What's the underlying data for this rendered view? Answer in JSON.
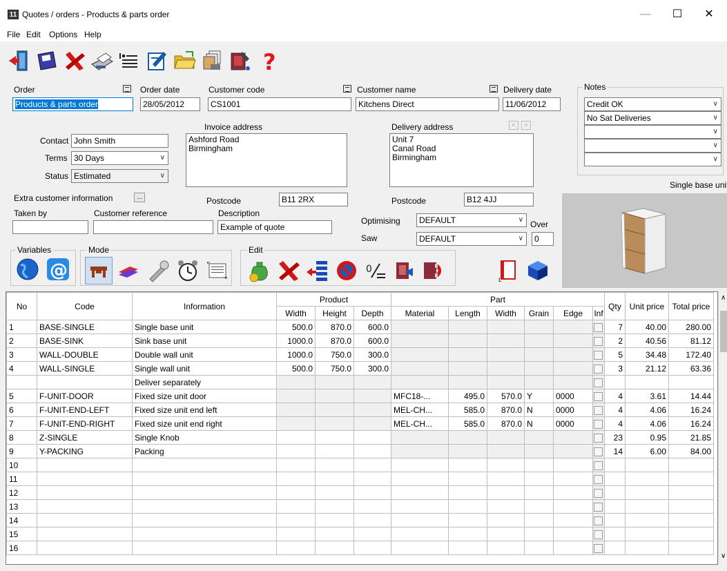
{
  "window": {
    "title": "Quotes / orders - Products & parts order",
    "min": "—",
    "max": "☐",
    "close": "✕",
    "app_icon_text": "11"
  },
  "menu": [
    "File",
    "Edit",
    "Options",
    "Help"
  ],
  "toolbar_icons": [
    "exit-icon",
    "save-icon",
    "delete-icon",
    "print-icon",
    "list-format-icon",
    "edit-note-icon",
    "open-folder-icon",
    "copy-orders-icon",
    "book-tools-icon",
    "help-icon"
  ],
  "help_glyph": "?",
  "order": {
    "label": "Order",
    "value": "Products & parts order",
    "order_date_label": "Order date",
    "order_date": "28/05/2012",
    "customer_code_label": "Customer code",
    "customer_code": "CS1001",
    "customer_name_label": "Customer name",
    "customer_name": "Kitchens Direct",
    "delivery_date_label": "Delivery date",
    "delivery_date": "11/06/2012"
  },
  "notes": {
    "label": "Notes",
    "items": [
      "Credit OK",
      "No Sat Deliveries",
      "",
      "",
      ""
    ]
  },
  "contact": {
    "contact_label": "Contact",
    "contact": "John Smith",
    "terms_label": "Terms",
    "terms": "30 Days",
    "status_label": "Status",
    "status": "Estimated"
  },
  "invoice": {
    "label": "Invoice address",
    "lines": [
      "Ashford Road",
      "Birmingham"
    ],
    "postcode_label": "Postcode",
    "postcode": "B11 2RX"
  },
  "delivery": {
    "label": "Delivery address",
    "lines": [
      "Unit 7",
      "Canal Road",
      "Birmingham"
    ],
    "postcode_label": "Postcode",
    "postcode": "B12 4JJ",
    "prev": "<",
    "next": ">"
  },
  "extra": {
    "label": "Extra customer information",
    "btn": "...",
    "taken_by_label": "Taken by",
    "taken_by": "",
    "customer_ref_label": "Customer reference",
    "customer_ref": "",
    "description_label": "Description",
    "description": "Example of quote"
  },
  "optimising": {
    "label": "Optimising",
    "value": "DEFAULT",
    "saw_label": "Saw",
    "saw": "DEFAULT",
    "over_label": "Over",
    "over": "0"
  },
  "preview": {
    "label": "Single base unit"
  },
  "groups": {
    "variables": "Variables",
    "mode": "Mode",
    "edit": "Edit"
  },
  "grid": {
    "headers": {
      "no": "No",
      "code": "Code",
      "information": "Information",
      "product": "Product",
      "width": "Width",
      "height": "Height",
      "depth": "Depth",
      "part": "Part",
      "material": "Material",
      "length": "Length",
      "pwidth": "Width",
      "grain": "Grain",
      "edge": "Edge",
      "inf": "Inf",
      "qty": "Qty",
      "unit_price": "Unit price",
      "total_price": "Total price"
    },
    "rows": [
      {
        "no": "1",
        "code": "BASE-SINGLE",
        "info": "Single base unit",
        "w": "500.0",
        "h": "870.0",
        "d": "600.0",
        "mat": "",
        "len": "",
        "pw": "",
        "grain": "",
        "edge": "",
        "qty": "7",
        "unit": "40.00",
        "total": "280.00"
      },
      {
        "no": "2",
        "code": "BASE-SINK",
        "info": "Sink base unit",
        "w": "1000.0",
        "h": "870.0",
        "d": "600.0",
        "mat": "",
        "len": "",
        "pw": "",
        "grain": "",
        "edge": "",
        "qty": "2",
        "unit": "40.56",
        "total": "81.12"
      },
      {
        "no": "3",
        "code": "WALL-DOUBLE",
        "info": "Double wall unit",
        "w": "1000.0",
        "h": "750.0",
        "d": "300.0",
        "mat": "",
        "len": "",
        "pw": "",
        "grain": "",
        "edge": "",
        "qty": "5",
        "unit": "34.48",
        "total": "172.40"
      },
      {
        "no": "4",
        "code": "WALL-SINGLE",
        "info": "Single wall unit",
        "w": "500.0",
        "h": "750.0",
        "d": "300.0",
        "mat": "",
        "len": "",
        "pw": "",
        "grain": "",
        "edge": "",
        "qty": "3",
        "unit": "21.12",
        "total": "63.36"
      },
      {
        "no": "",
        "code": "",
        "info": "Deliver separately",
        "w": "",
        "h": "",
        "d": "",
        "mat": "",
        "len": "",
        "pw": "",
        "grain": "",
        "edge": "",
        "qty": "",
        "unit": "",
        "total": ""
      },
      {
        "no": "5",
        "code": "F-UNIT-DOOR",
        "info": "Fixed size unit door",
        "w": "",
        "h": "",
        "d": "",
        "mat": "MFC18-...",
        "len": "495.0",
        "pw": "570.0",
        "grain": "Y",
        "edge": "0000",
        "qty": "4",
        "unit": "3.61",
        "total": "14.44"
      },
      {
        "no": "6",
        "code": "F-UNIT-END-LEFT",
        "info": "Fixed size unit end left",
        "w": "",
        "h": "",
        "d": "",
        "mat": "MEL-CH...",
        "len": "585.0",
        "pw": "870.0",
        "grain": "N",
        "edge": "0000",
        "qty": "4",
        "unit": "4.06",
        "total": "16.24"
      },
      {
        "no": "7",
        "code": "F-UNIT-END-RIGHT",
        "info": "Fixed size unit end right",
        "w": "",
        "h": "",
        "d": "",
        "mat": "MEL-CH...",
        "len": "585.0",
        "pw": "870.0",
        "grain": "N",
        "edge": "0000",
        "qty": "4",
        "unit": "4.06",
        "total": "16.24"
      },
      {
        "no": "8",
        "code": "Z-SINGLE",
        "info": "Single Knob",
        "w": "",
        "h": "",
        "d": "",
        "mat": "",
        "len": "",
        "pw": "",
        "grain": "",
        "edge": "",
        "qty": "23",
        "unit": "0.95",
        "total": "21.85"
      },
      {
        "no": "9",
        "code": "Y-PACKING",
        "info": "Packing",
        "w": "",
        "h": "",
        "d": "",
        "mat": "",
        "len": "",
        "pw": "",
        "grain": "",
        "edge": "",
        "qty": "14",
        "unit": "6.00",
        "total": "84.00"
      },
      {
        "no": "10",
        "code": "",
        "info": "",
        "w": "",
        "h": "",
        "d": "",
        "mat": "",
        "len": "",
        "pw": "",
        "grain": "",
        "edge": "",
        "qty": "",
        "unit": "",
        "total": ""
      },
      {
        "no": "11",
        "code": "",
        "info": "",
        "w": "",
        "h": "",
        "d": "",
        "mat": "",
        "len": "",
        "pw": "",
        "grain": "",
        "edge": "",
        "qty": "",
        "unit": "",
        "total": ""
      },
      {
        "no": "12",
        "code": "",
        "info": "",
        "w": "",
        "h": "",
        "d": "",
        "mat": "",
        "len": "",
        "pw": "",
        "grain": "",
        "edge": "",
        "qty": "",
        "unit": "",
        "total": ""
      },
      {
        "no": "13",
        "code": "",
        "info": "",
        "w": "",
        "h": "",
        "d": "",
        "mat": "",
        "len": "",
        "pw": "",
        "grain": "",
        "edge": "",
        "qty": "",
        "unit": "",
        "total": ""
      },
      {
        "no": "14",
        "code": "",
        "info": "",
        "w": "",
        "h": "",
        "d": "",
        "mat": "",
        "len": "",
        "pw": "",
        "grain": "",
        "edge": "",
        "qty": "",
        "unit": "",
        "total": ""
      },
      {
        "no": "15",
        "code": "",
        "info": "",
        "w": "",
        "h": "",
        "d": "",
        "mat": "",
        "len": "",
        "pw": "",
        "grain": "",
        "edge": "",
        "qty": "",
        "unit": "",
        "total": ""
      },
      {
        "no": "16",
        "code": "",
        "info": "",
        "w": "",
        "h": "",
        "d": "",
        "mat": "",
        "len": "",
        "pw": "",
        "grain": "",
        "edge": "",
        "qty": "",
        "unit": "",
        "total": ""
      }
    ]
  }
}
